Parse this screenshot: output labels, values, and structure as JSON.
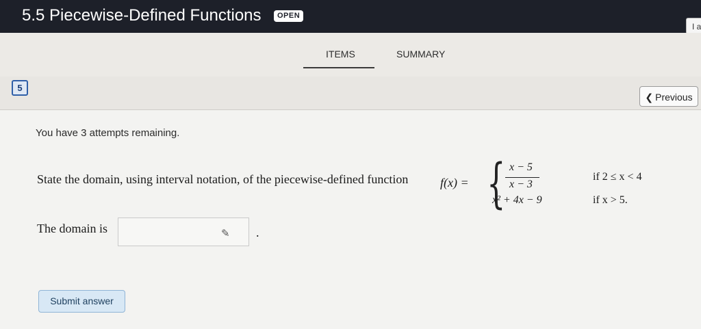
{
  "header": {
    "title": "5.5 Piecewise-Defined Functions",
    "badge": "OPEN",
    "corner_label": "I a"
  },
  "tabs": [
    {
      "label": "ITEMS"
    },
    {
      "label": "SUMMARY"
    }
  ],
  "question": {
    "number": "5",
    "previous_label": "Previous",
    "attempts_text": "You have 3 attempts remaining.",
    "prompt": "State the domain, using interval notation, of the piecewise-defined function",
    "function_lhs": "f(x) =",
    "piece1_numerator": "x − 5",
    "piece1_denominator": "x − 3",
    "piece1_condition": "if 2 ≤ x < 4",
    "piece2_expression": "x² + 4x − 9",
    "piece2_condition": "if x > 5.",
    "answer_label": "The domain is",
    "answer_value": "",
    "answer_suffix": ".",
    "submit_label": "Submit answer"
  },
  "icons": {
    "previous": "chevron-left-icon",
    "answer_tool": "pencil-icon"
  }
}
